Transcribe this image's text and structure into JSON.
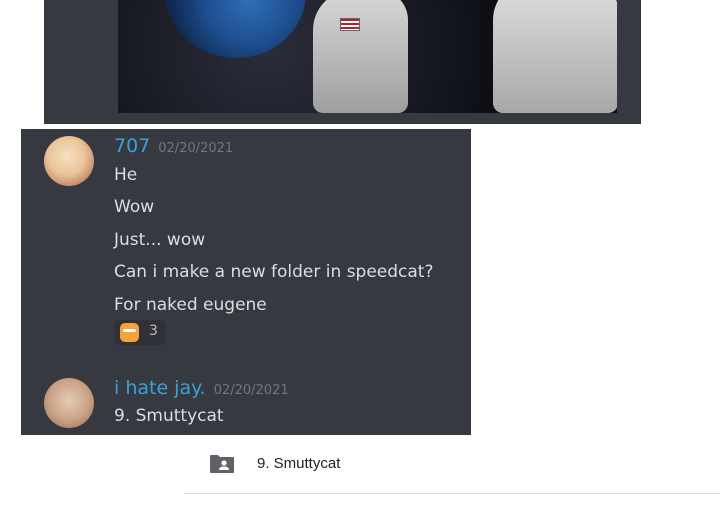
{
  "meme": {
    "description_icon": "astronauts-earth-image"
  },
  "messages": [
    {
      "user": "707",
      "date": "02/20/2021",
      "lines": [
        "He",
        "Wow",
        "Just... wow",
        "Can i make a new folder in speedcat?",
        "For naked eugene"
      ],
      "reaction": {
        "emoji": "orange-face-emoji",
        "count": "3"
      }
    },
    {
      "user": "i hate jay.",
      "date": "02/20/2021",
      "lines": [
        "9. Smuttycat"
      ]
    }
  ],
  "file_row": {
    "icon": "shared-folder-icon",
    "name": "9. Smuttycat"
  },
  "colors": {
    "chat_bg": "#36393f",
    "username": "#3ea0d8",
    "timestamp": "#72767d",
    "message_text": "#dcddde"
  }
}
